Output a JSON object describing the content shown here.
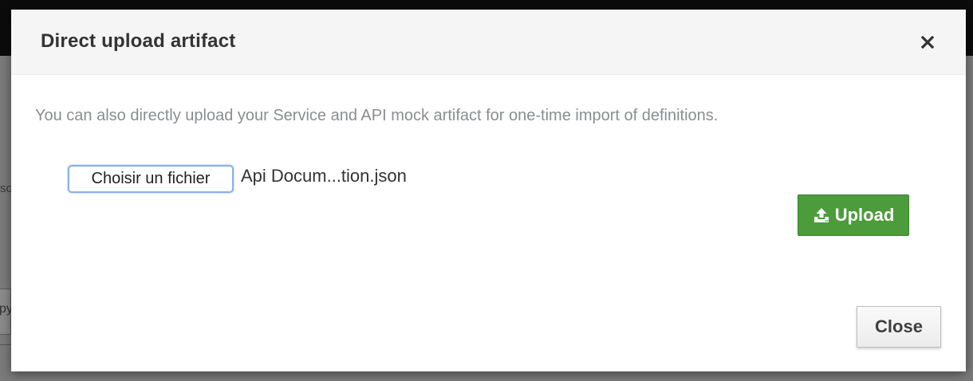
{
  "background": {
    "fragment_text": "so",
    "field_fragment_text": "py"
  },
  "modal": {
    "title": "Direct upload artifact",
    "close_icon": "close-icon",
    "description": "You can also directly upload your Service and API mock artifact for one-time import of definitions.",
    "file_input": {
      "button_label": "Choisir un fichier",
      "selected_file": "Api Docum...tion.json"
    },
    "upload_button": {
      "label": "Upload",
      "icon": "upload-icon",
      "color": "#4c9c3b"
    },
    "close_button": {
      "label": "Close"
    }
  }
}
